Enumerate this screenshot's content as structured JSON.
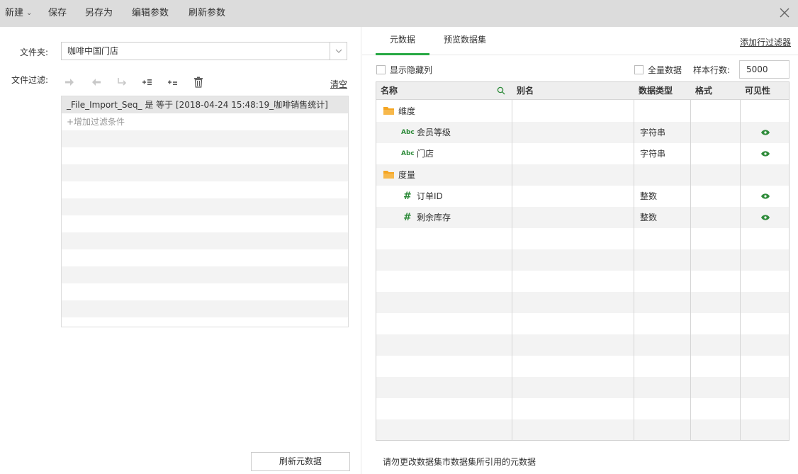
{
  "toolbar": {
    "new_label": "新建",
    "save_label": "保存",
    "save_as_label": "另存为",
    "edit_params_label": "编辑参数",
    "refresh_params_label": "刷新参数"
  },
  "left": {
    "folder_label": "文件夹:",
    "folder_value": "咖啡中国门店",
    "filter_label": "文件过滤:",
    "clear_label": "清空",
    "filter_condition": "_File_Import_Seq_ 是 等于 [2018-04-24 15:48:19_咖啡销售统计]",
    "add_condition_label": "+增加过滤条件",
    "refresh_metadata_label": "刷新元数据"
  },
  "right": {
    "tabs": [
      {
        "label": "元数据",
        "active": true
      },
      {
        "label": "预览数据集",
        "active": false
      }
    ],
    "add_row_filter_label": "添加行过滤器",
    "show_hidden_label": "显示隐藏列",
    "all_data_label": "全量数据",
    "sample_rows_label": "样本行数:",
    "sample_rows_value": "5000",
    "columns": [
      "名称",
      "别名",
      "数据类型",
      "格式",
      "可见性"
    ],
    "rows": [
      {
        "kind": "folder",
        "name": "维度",
        "alias": "",
        "type": "",
        "format": "",
        "visible": false
      },
      {
        "kind": "text",
        "icon": "Abc",
        "name": "会员等级",
        "alias": "",
        "type": "字符串",
        "format": "",
        "visible": true
      },
      {
        "kind": "text",
        "icon": "Abc",
        "name": "门店",
        "alias": "",
        "type": "字符串",
        "format": "",
        "visible": true
      },
      {
        "kind": "folder",
        "name": "度量",
        "alias": "",
        "type": "",
        "format": "",
        "visible": false
      },
      {
        "kind": "number",
        "icon": "#",
        "name": "订单ID",
        "alias": "",
        "type": "整数",
        "format": "",
        "visible": true
      },
      {
        "kind": "number",
        "icon": "#",
        "name": "剩余库存",
        "alias": "",
        "type": "整数",
        "format": "",
        "visible": true
      }
    ],
    "note": "请勿更改数据集市数据集所引用的元数据"
  },
  "colors": {
    "accent_green": "#27a844",
    "icon_green": "#2e8b3a",
    "folder_orange": "#f5a623",
    "toolbar_bg": "#dcdcdc"
  }
}
